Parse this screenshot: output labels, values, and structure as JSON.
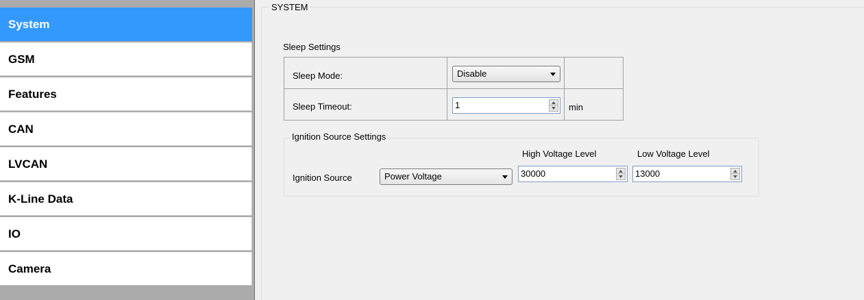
{
  "sidebar": {
    "items": [
      {
        "label": "System",
        "active": true
      },
      {
        "label": "GSM",
        "active": false
      },
      {
        "label": "Features",
        "active": false
      },
      {
        "label": "CAN",
        "active": false
      },
      {
        "label": "LVCAN",
        "active": false
      },
      {
        "label": "K-Line Data",
        "active": false
      },
      {
        "label": "IO",
        "active": false
      },
      {
        "label": "Camera",
        "active": false
      }
    ]
  },
  "system": {
    "title": "SYSTEM",
    "sleep": {
      "title": "Sleep Settings",
      "mode_label": "Sleep Mode:",
      "mode_value": "Disable",
      "timeout_label": "Sleep Timeout:",
      "timeout_value": "1",
      "timeout_unit": "min"
    },
    "ignition": {
      "title": "Ignition Source Settings",
      "source_label": "Ignition Source",
      "source_value": "Power Voltage",
      "high_label": "High Voltage Level",
      "high_value": "30000",
      "low_label": "Low Voltage Level",
      "low_value": "13000"
    }
  },
  "colors": {
    "active_item": "#3399ff",
    "sidebar_bg": "#ababab",
    "panel_bg": "#f0f0f0"
  }
}
